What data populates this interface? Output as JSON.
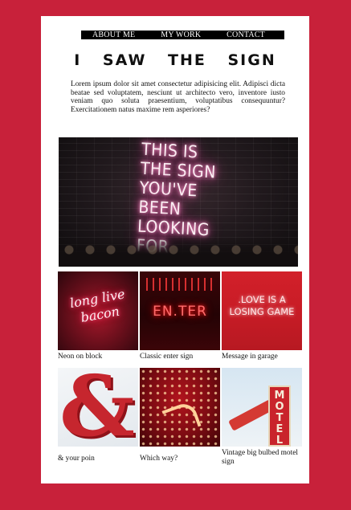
{
  "nav": {
    "items": [
      {
        "label": "ABOUT ME"
      },
      {
        "label": "MY WORK"
      },
      {
        "label": "CONTACT"
      }
    ]
  },
  "header": {
    "title": "I SAW THE SIGN"
  },
  "intro": {
    "text": "Lorem ipsum dolor sit amet consectetur adipisicing elit. Adipisci dicta beatae sed voluptatem, nesciunt ut architecto vero, inventore iusto veniam quo soluta praesentium, voluptatibus consequuntur? Exercitationem natus maxime rem asperiores?"
  },
  "hero": {
    "neon_lines": [
      "THIS IS",
      "THE SIGN",
      "YOU'VE BEEN",
      "LOOKING FOR"
    ]
  },
  "gallery": {
    "items": [
      {
        "caption": "Neon on block",
        "sign_text": "long live bacon"
      },
      {
        "caption": "Classic enter sign",
        "sign_text": "EN.TER"
      },
      {
        "caption": "Message in garage",
        "sign_text_1": ".LOVE IS A",
        "sign_text_2": "LOSING GAME"
      },
      {
        "caption": "& your poin",
        "sign_text": "&"
      },
      {
        "caption": "Which way?"
      },
      {
        "caption": "Vintage big bulbed motel sign",
        "sign_text": "MOTEL"
      }
    ]
  },
  "colors": {
    "background": "#c8213a",
    "page": "#ffffff",
    "nav": "#000000"
  }
}
